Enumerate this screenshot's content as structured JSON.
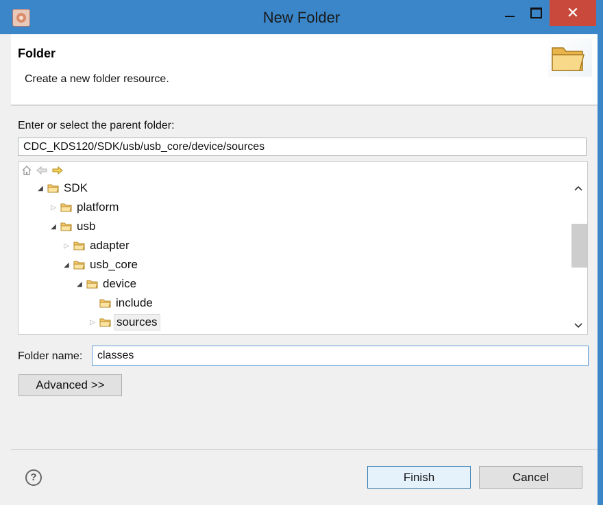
{
  "window": {
    "title": "New Folder",
    "close_glyph": "✕"
  },
  "header": {
    "title": "Folder",
    "description": "Create a new folder resource."
  },
  "form": {
    "parent_label": "Enter or select the parent folder:",
    "parent_path": "CDC_KDS120/SDK/usb/usb_core/device/sources",
    "folder_name_label": "Folder name:",
    "folder_name_value": "classes",
    "advanced_label": "Advanced >>"
  },
  "tree": {
    "items": [
      {
        "label": "SDK",
        "level": 0,
        "expanded": true
      },
      {
        "label": "platform",
        "level": 1,
        "expanded": false
      },
      {
        "label": "usb",
        "level": 1,
        "expanded": true
      },
      {
        "label": "adapter",
        "level": 2,
        "expanded": false
      },
      {
        "label": "usb_core",
        "level": 2,
        "expanded": true
      },
      {
        "label": "device",
        "level": 3,
        "expanded": true
      },
      {
        "label": "include",
        "level": 4,
        "expanded": null
      },
      {
        "label": "sources",
        "level": 4,
        "expanded": false,
        "selected": true
      }
    ]
  },
  "buttons": {
    "finish": "Finish",
    "cancel": "Cancel",
    "help": "?"
  },
  "colors": {
    "titlebar": "#3a86c8",
    "close": "#c94a3c",
    "folder": "#f5c96a",
    "default_button_border": "#3c7fb1"
  }
}
